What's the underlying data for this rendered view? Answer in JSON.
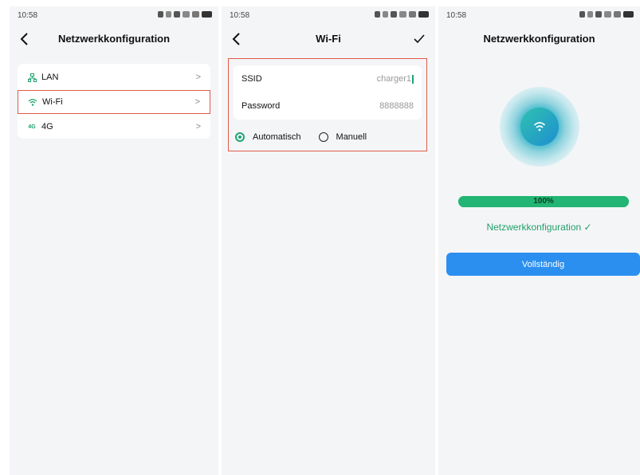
{
  "screen1": {
    "time": "10:58",
    "title": "Netzwerkkonfiguration",
    "items": [
      {
        "label": "LAN",
        "icon": "lan-icon",
        "chevron": ">"
      },
      {
        "label": "Wi-Fi",
        "icon": "wifi-icon",
        "chevron": ">",
        "selected": true
      },
      {
        "label": "4G",
        "icon": "4g-icon",
        "icon_text": "4G",
        "chevron": ">"
      }
    ]
  },
  "screen2": {
    "time": "10:58",
    "title": "Wi-Fi",
    "fields": [
      {
        "label": "SSID",
        "value": "charger1"
      },
      {
        "label": "Password",
        "value": "8888888"
      }
    ],
    "modes": [
      {
        "label": "Automatisch",
        "selected": true
      },
      {
        "label": "Manuell",
        "selected": false
      }
    ]
  },
  "screen3": {
    "time": "10:58",
    "title": "Netzwerkkonfiguration",
    "progress": 100,
    "progress_text": "100%",
    "status": "Netzwerkkonfiguration ✓",
    "button": "Vollständig"
  },
  "colors": {
    "accent_green": "#22b573",
    "highlight_red": "#e05a4a",
    "button_blue": "#2b8ff0"
  }
}
